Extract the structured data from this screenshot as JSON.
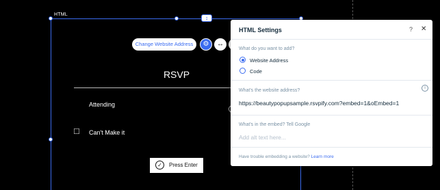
{
  "editor": {
    "frame_tag": "HTML",
    "anchor_glyph": "↕",
    "change_address_label": "Change Website Address",
    "gear_glyph": "⚙",
    "stretch_glyph": "↔"
  },
  "rsvp": {
    "title": "RSVP",
    "attending_label": "Attending",
    "cant_make_it_label": "Can't Make it",
    "cant_icon": "☐",
    "press_enter_label": "Press Enter",
    "check_glyph": "✓"
  },
  "panel": {
    "title": "HTML Settings",
    "help_glyph": "?",
    "close_glyph": "✕",
    "question": "What do you want to add?",
    "options": [
      {
        "label": "Website Address",
        "selected": true
      },
      {
        "label": "Code",
        "selected": false
      }
    ],
    "address_label": "What's the website address?",
    "info_glyph": "i",
    "address_value": "https://beautypopupsample.rsvpify.com?embed=1&oEmbed=1",
    "embed_label": "What's in the embed? Tell Google",
    "alt_placeholder": "Add alt text here...",
    "trouble_text": "Have trouble embedding a website?",
    "learn_more": "Learn more"
  },
  "colors": {
    "accent": "#3b6cf0",
    "canvas_bg": "#000000",
    "panel_text": "#162d3d",
    "muted": "#7a92a5"
  },
  "icons": {
    "settings": "gear-icon",
    "stretch": "horizontal-stretch-icon",
    "close": "close-icon",
    "help": "help-icon",
    "info": "info-icon",
    "check": "check-circle-icon",
    "cant_make_it": "calendar-decline-icon"
  }
}
